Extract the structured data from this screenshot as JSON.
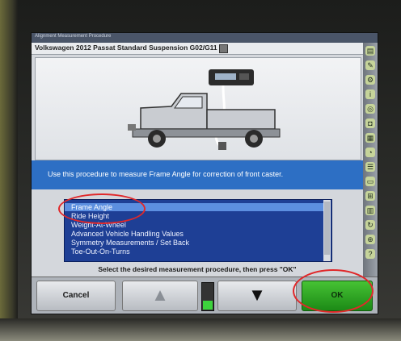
{
  "window": {
    "small_title": "Alignment Measurement Procedure",
    "title": "Volkswagen 2012 Passat Standard Suspension G02/G11"
  },
  "info_bar": {
    "text": "Use this procedure to measure Frame Angle for correction of front caster."
  },
  "procedure_list": {
    "items": [
      {
        "label": "Frame Angle",
        "selected": true
      },
      {
        "label": "Ride Height",
        "selected": false
      },
      {
        "label": "Weight-At-Wheel",
        "selected": false
      },
      {
        "label": "Advanced Vehicle Handling Values",
        "selected": false
      },
      {
        "label": "Symmetry Measurements / Set Back",
        "selected": false
      },
      {
        "label": "Toe-Out-On-Turns",
        "selected": false
      }
    ]
  },
  "instruction": {
    "text": "Select the desired measurement procedure, then press \"OK\""
  },
  "toolbar": {
    "cancel_label": "Cancel",
    "ok_label": "OK",
    "up_icon": "arrow-up-icon",
    "down_icon": "arrow-down-icon",
    "level_fraction": 0.35
  },
  "colors": {
    "info_bar": "#2d6fc4",
    "list_background": "#1e3f95",
    "list_selected": "#5c8fe0",
    "ok_button": "#2fa722",
    "annotation_circle": "#e0282a"
  }
}
